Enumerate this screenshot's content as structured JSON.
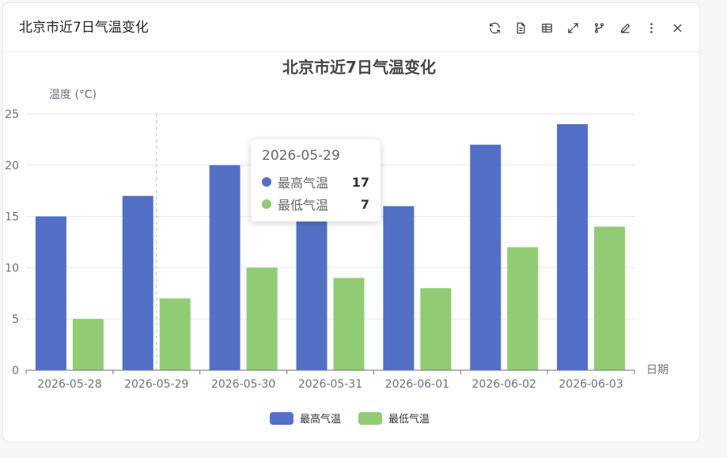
{
  "header": {
    "title": "北京市近7日气温变化",
    "toolbar": [
      {
        "icon": "refresh-icon",
        "label": "refresh"
      },
      {
        "icon": "document-icon",
        "label": "data view"
      },
      {
        "icon": "table-icon",
        "label": "table"
      },
      {
        "icon": "expand-icon",
        "label": "fullscreen"
      },
      {
        "icon": "branch-icon",
        "label": "chart type"
      },
      {
        "icon": "edit-icon",
        "label": "edit"
      },
      {
        "icon": "more-icon",
        "label": "more"
      },
      {
        "icon": "close-icon",
        "label": "close"
      }
    ]
  },
  "chart_data": {
    "type": "bar",
    "title": "北京市近7日气温变化",
    "ylabel": "温度 (°C)",
    "xlabel": "日期",
    "ylim": [
      0,
      25
    ],
    "yticks": [
      0,
      5,
      10,
      15,
      20,
      25
    ],
    "grid": true,
    "legend_position": "bottom",
    "categories": [
      "2026-05-28",
      "2026-05-29",
      "2026-05-30",
      "2026-05-31",
      "2026-06-01",
      "2026-06-02",
      "2026-06-03"
    ],
    "series": [
      {
        "name": "最高气温",
        "color": "#5470c6",
        "values": [
          15,
          17,
          20,
          15,
          16,
          22,
          24
        ]
      },
      {
        "name": "最低气温",
        "color": "#91cc75",
        "values": [
          5,
          7,
          10,
          9,
          8,
          12,
          14
        ]
      }
    ]
  },
  "tooltip": {
    "title": "2026-05-29",
    "rows": [
      {
        "name": "最高气温",
        "value": "17",
        "color": "#5470c6"
      },
      {
        "name": "最低气温",
        "value": "7",
        "color": "#91cc75"
      }
    ]
  }
}
